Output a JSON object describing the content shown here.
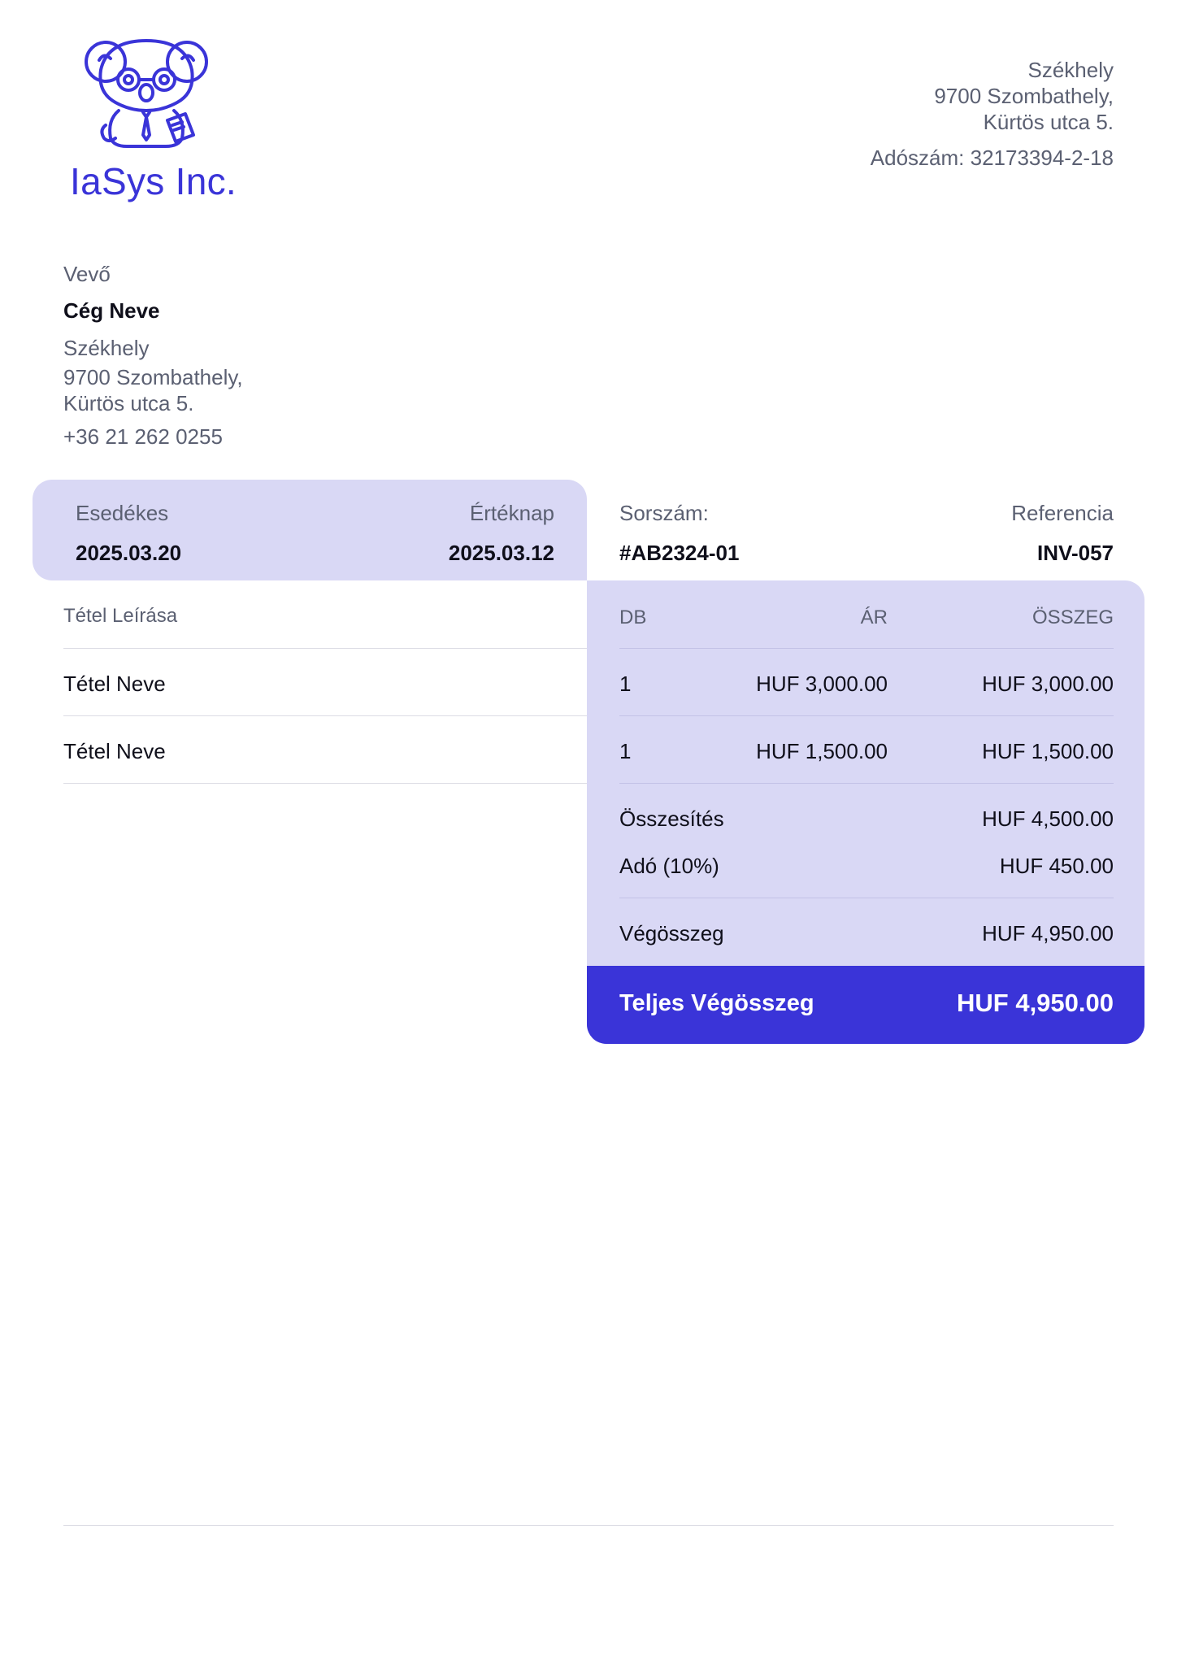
{
  "company": {
    "name": "IaSys Inc.",
    "logo_icon": "koala-mascot-icon",
    "address_label": "Székhely",
    "address_line1": "9700 Szombathely,",
    "address_line2": "Kürtös utca 5.",
    "tax_id": "Adószám: 32173394-2-18"
  },
  "buyer": {
    "label": "Vevő",
    "name": "Cég Neve",
    "address_label": "Székhely",
    "address_line1": "9700 Szombathely,",
    "address_line2": "Kürtös utca 5.",
    "phone": "+36 21 262 0255"
  },
  "dates": {
    "due_label": "Esedékes",
    "due_value": "2025.03.20",
    "value_date_label": "Értéknap",
    "value_date_value": "2025.03.12"
  },
  "invoice": {
    "number_label": "Sorszám:",
    "number_value": "#AB2324-01",
    "reference_label": "Referencia",
    "reference_value": "INV-057"
  },
  "table": {
    "headers": {
      "description": "Tétel Leírása",
      "qty": "DB",
      "price": "ÁR",
      "amount": "ÖSSZEG"
    },
    "rows": [
      {
        "name": "Tétel Neve",
        "qty": "1",
        "price": "HUF 3,000.00",
        "amount": "HUF 3,000.00"
      },
      {
        "name": "Tétel Neve",
        "qty": "1",
        "price": "HUF 1,500.00",
        "amount": "HUF 1,500.00"
      }
    ]
  },
  "summary": {
    "subtotal_label": "Összesítés",
    "subtotal_value": "HUF 4,500.00",
    "tax_label": "Adó (10%)",
    "tax_value": "HUF 450.00",
    "final_label": "Végösszeg",
    "final_value": "HUF 4,950.00",
    "grand_total_label": "Teljes Végösszeg",
    "grand_total_value": "HUF 4,950.00"
  },
  "colors": {
    "accent": "#3a34d8",
    "panel": "#d9d8f5",
    "muted_text": "#5b6072"
  }
}
